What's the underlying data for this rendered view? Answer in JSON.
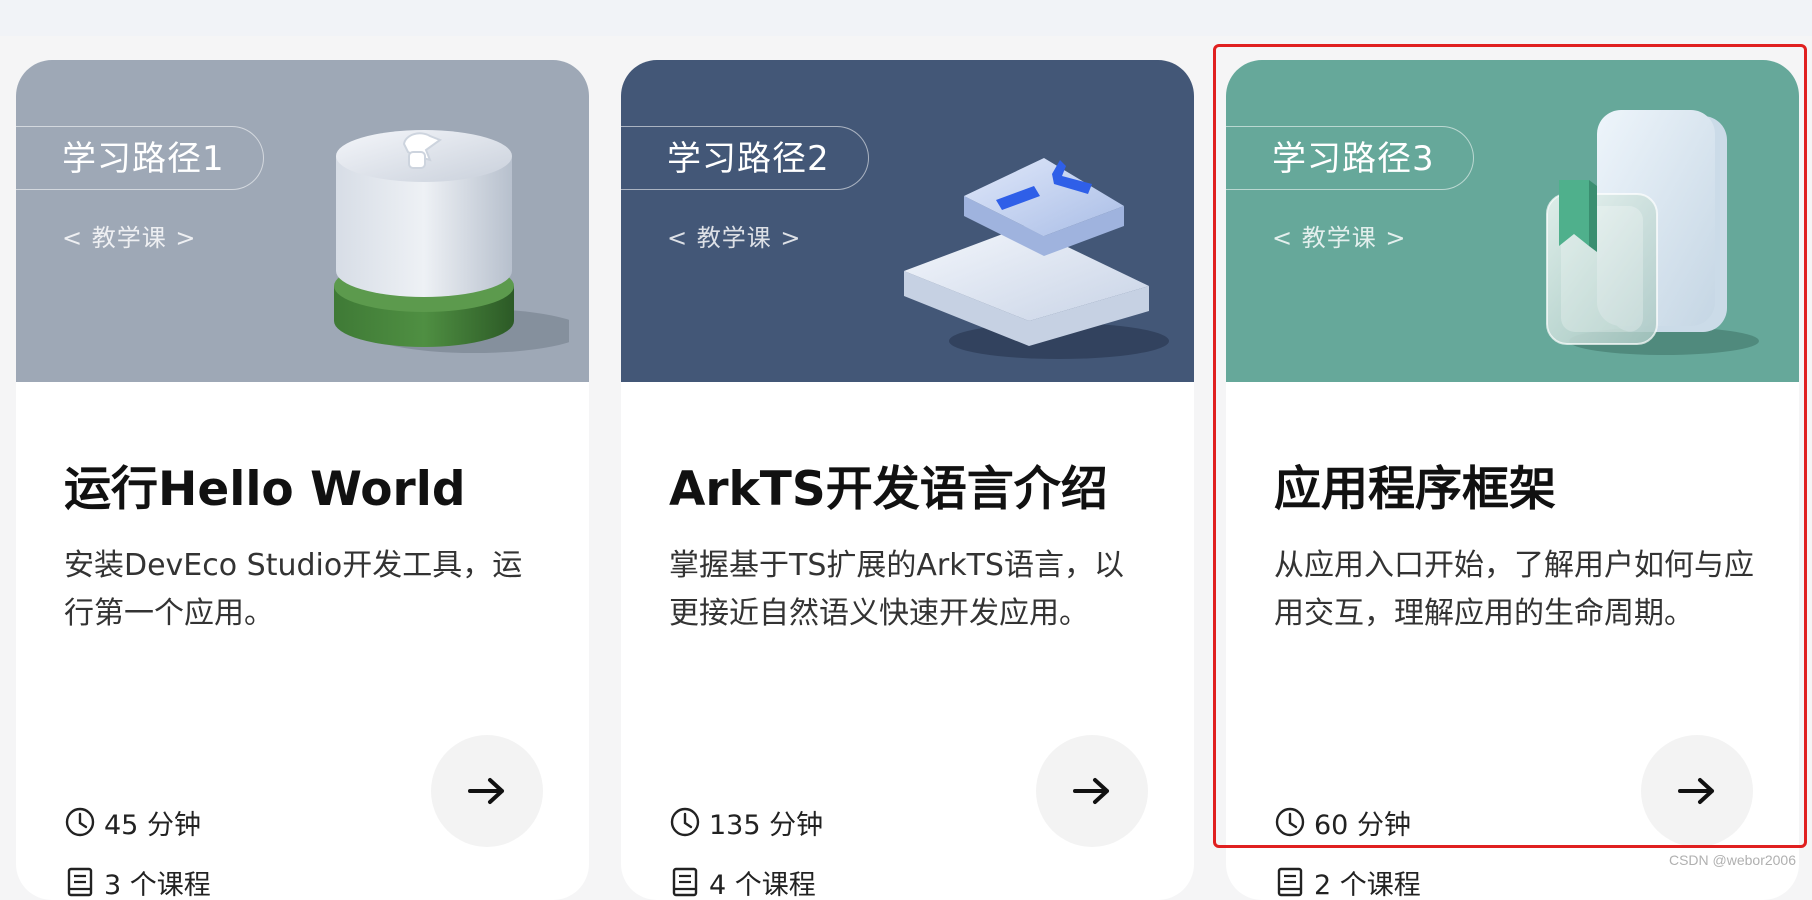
{
  "colors": {
    "card1_banner": "#9ea8b6",
    "card2_banner": "#435777",
    "card3_banner": "#66a89a",
    "highlight": "#e02020"
  },
  "cards": [
    {
      "tag": "学习路径1",
      "subtitle": "< 教学课 >",
      "title": "运行Hello World",
      "description": "安装DevEco Studio开发工具，运行第一个应用。",
      "duration": "45 分钟",
      "courses": "3 个课程",
      "illustration": "cylinder-wrench-icon"
    },
    {
      "tag": "学习路径2",
      "subtitle": "< 教学课 >",
      "title": "ArkTS开发语言介绍",
      "description": "掌握基于TS扩展的ArkTS语言，以更接近自然语义快速开发应用。",
      "duration": "135 分钟",
      "courses": "4 个课程",
      "illustration": "code-blocks-icon"
    },
    {
      "tag": "学习路径3",
      "subtitle": "< 教学课 >",
      "title": "应用程序框架",
      "description": "从应用入口开始，了解用户如何与应用交互，理解应用的生命周期。",
      "duration": "60 分钟",
      "courses": "2 个课程",
      "illustration": "glass-panels-icon"
    }
  ],
  "watermark": "CSDN @webor2006"
}
